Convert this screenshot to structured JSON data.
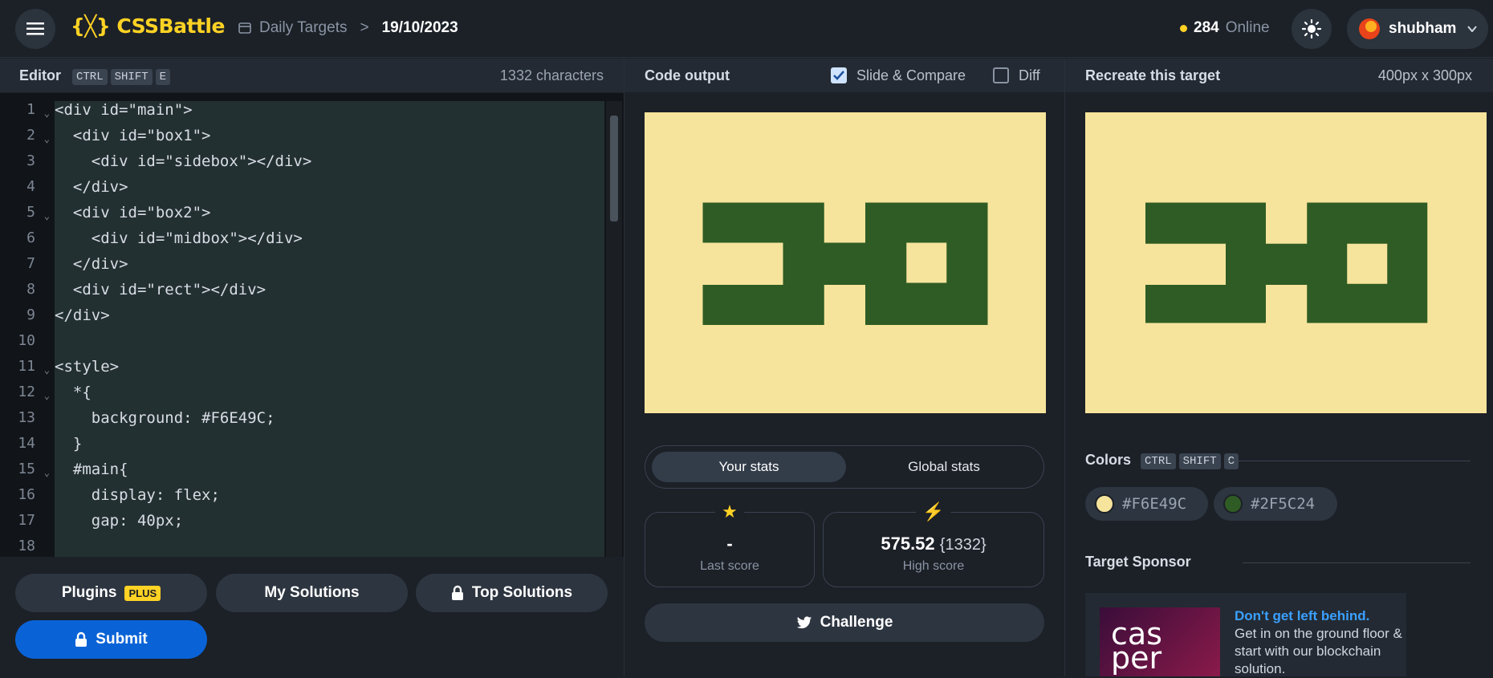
{
  "header": {
    "logo_text": "{╳} CSSBattle",
    "breadcrumb_link": "Daily Targets",
    "breadcrumb_sep": ">",
    "breadcrumb_date": "19/10/2023",
    "online_count": "284",
    "online_label": "Online",
    "username": "shubham"
  },
  "editor": {
    "title": "Editor",
    "shortcut": [
      "CTRL",
      "SHIFT",
      "E"
    ],
    "char_count": "1332 characters",
    "lines": [
      "<div id=\"main\">",
      "  <div id=\"box1\">",
      "    <div id=\"sidebox\"></div>",
      "  </div>",
      "  <div id=\"box2\">",
      "    <div id=\"midbox\"></div>",
      "  </div>",
      "  <div id=\"rect\"></div>",
      "</div>",
      "",
      "<style>",
      "  *{",
      "    background: #F6E49C;",
      "  }",
      "  #main{",
      "    display: flex;",
      "    gap: 40px;",
      ""
    ]
  },
  "buttons": {
    "plugins": "Plugins",
    "plugins_badge": "PLUS",
    "my_solutions": "My Solutions",
    "top_solutions": "Top Solutions",
    "submit": "Submit"
  },
  "output": {
    "title": "Code output",
    "slide_compare": "Slide & Compare",
    "diff": "Diff",
    "slide_compare_checked": true,
    "diff_checked": false
  },
  "stats": {
    "tab_yours": "Your stats",
    "tab_global": "Global stats",
    "last_score": "-",
    "last_score_label": "Last score",
    "high_score": "575.52",
    "high_score_chars": "{1332}",
    "high_score_label": "High score",
    "challenge": "Challenge"
  },
  "target": {
    "title": "Recreate this target",
    "size": "400px x 300px",
    "colors_title": "Colors",
    "colors_shortcut": [
      "CTRL",
      "SHIFT",
      "C"
    ],
    "colors": [
      "#F6E49C",
      "#2F5C24"
    ],
    "sponsor_title": "Target Sponsor",
    "sponsor_headline": "Don't get left behind.",
    "sponsor_text": "Get in on the ground floor & start with our blockchain solution.",
    "sponsor_logo": "cas per"
  },
  "palette": {
    "accent": "#FFD224",
    "bg": "#F6E49C",
    "shape": "#2F5C24",
    "link": "#3aa0ff",
    "submit": "#0a63d6"
  }
}
